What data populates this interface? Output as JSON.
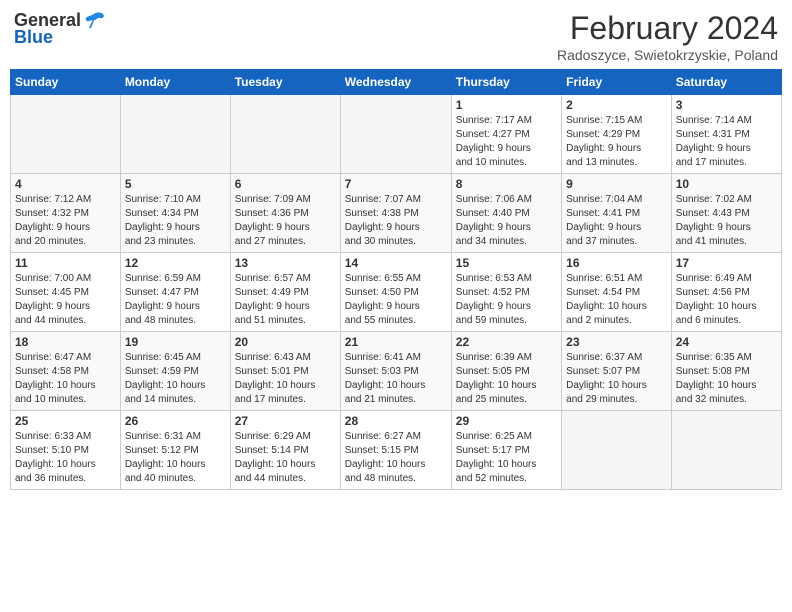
{
  "header": {
    "logo_general": "General",
    "logo_blue": "Blue",
    "month_year": "February 2024",
    "location": "Radoszyce, Swietokrzyskie, Poland"
  },
  "weekdays": [
    "Sunday",
    "Monday",
    "Tuesday",
    "Wednesday",
    "Thursday",
    "Friday",
    "Saturday"
  ],
  "weeks": [
    [
      {
        "day": "",
        "info": ""
      },
      {
        "day": "",
        "info": ""
      },
      {
        "day": "",
        "info": ""
      },
      {
        "day": "",
        "info": ""
      },
      {
        "day": "1",
        "info": "Sunrise: 7:17 AM\nSunset: 4:27 PM\nDaylight: 9 hours\nand 10 minutes."
      },
      {
        "day": "2",
        "info": "Sunrise: 7:15 AM\nSunset: 4:29 PM\nDaylight: 9 hours\nand 13 minutes."
      },
      {
        "day": "3",
        "info": "Sunrise: 7:14 AM\nSunset: 4:31 PM\nDaylight: 9 hours\nand 17 minutes."
      }
    ],
    [
      {
        "day": "4",
        "info": "Sunrise: 7:12 AM\nSunset: 4:32 PM\nDaylight: 9 hours\nand 20 minutes."
      },
      {
        "day": "5",
        "info": "Sunrise: 7:10 AM\nSunset: 4:34 PM\nDaylight: 9 hours\nand 23 minutes."
      },
      {
        "day": "6",
        "info": "Sunrise: 7:09 AM\nSunset: 4:36 PM\nDaylight: 9 hours\nand 27 minutes."
      },
      {
        "day": "7",
        "info": "Sunrise: 7:07 AM\nSunset: 4:38 PM\nDaylight: 9 hours\nand 30 minutes."
      },
      {
        "day": "8",
        "info": "Sunrise: 7:06 AM\nSunset: 4:40 PM\nDaylight: 9 hours\nand 34 minutes."
      },
      {
        "day": "9",
        "info": "Sunrise: 7:04 AM\nSunset: 4:41 PM\nDaylight: 9 hours\nand 37 minutes."
      },
      {
        "day": "10",
        "info": "Sunrise: 7:02 AM\nSunset: 4:43 PM\nDaylight: 9 hours\nand 41 minutes."
      }
    ],
    [
      {
        "day": "11",
        "info": "Sunrise: 7:00 AM\nSunset: 4:45 PM\nDaylight: 9 hours\nand 44 minutes."
      },
      {
        "day": "12",
        "info": "Sunrise: 6:59 AM\nSunset: 4:47 PM\nDaylight: 9 hours\nand 48 minutes."
      },
      {
        "day": "13",
        "info": "Sunrise: 6:57 AM\nSunset: 4:49 PM\nDaylight: 9 hours\nand 51 minutes."
      },
      {
        "day": "14",
        "info": "Sunrise: 6:55 AM\nSunset: 4:50 PM\nDaylight: 9 hours\nand 55 minutes."
      },
      {
        "day": "15",
        "info": "Sunrise: 6:53 AM\nSunset: 4:52 PM\nDaylight: 9 hours\nand 59 minutes."
      },
      {
        "day": "16",
        "info": "Sunrise: 6:51 AM\nSunset: 4:54 PM\nDaylight: 10 hours\nand 2 minutes."
      },
      {
        "day": "17",
        "info": "Sunrise: 6:49 AM\nSunset: 4:56 PM\nDaylight: 10 hours\nand 6 minutes."
      }
    ],
    [
      {
        "day": "18",
        "info": "Sunrise: 6:47 AM\nSunset: 4:58 PM\nDaylight: 10 hours\nand 10 minutes."
      },
      {
        "day": "19",
        "info": "Sunrise: 6:45 AM\nSunset: 4:59 PM\nDaylight: 10 hours\nand 14 minutes."
      },
      {
        "day": "20",
        "info": "Sunrise: 6:43 AM\nSunset: 5:01 PM\nDaylight: 10 hours\nand 17 minutes."
      },
      {
        "day": "21",
        "info": "Sunrise: 6:41 AM\nSunset: 5:03 PM\nDaylight: 10 hours\nand 21 minutes."
      },
      {
        "day": "22",
        "info": "Sunrise: 6:39 AM\nSunset: 5:05 PM\nDaylight: 10 hours\nand 25 minutes."
      },
      {
        "day": "23",
        "info": "Sunrise: 6:37 AM\nSunset: 5:07 PM\nDaylight: 10 hours\nand 29 minutes."
      },
      {
        "day": "24",
        "info": "Sunrise: 6:35 AM\nSunset: 5:08 PM\nDaylight: 10 hours\nand 32 minutes."
      }
    ],
    [
      {
        "day": "25",
        "info": "Sunrise: 6:33 AM\nSunset: 5:10 PM\nDaylight: 10 hours\nand 36 minutes."
      },
      {
        "day": "26",
        "info": "Sunrise: 6:31 AM\nSunset: 5:12 PM\nDaylight: 10 hours\nand 40 minutes."
      },
      {
        "day": "27",
        "info": "Sunrise: 6:29 AM\nSunset: 5:14 PM\nDaylight: 10 hours\nand 44 minutes."
      },
      {
        "day": "28",
        "info": "Sunrise: 6:27 AM\nSunset: 5:15 PM\nDaylight: 10 hours\nand 48 minutes."
      },
      {
        "day": "29",
        "info": "Sunrise: 6:25 AM\nSunset: 5:17 PM\nDaylight: 10 hours\nand 52 minutes."
      },
      {
        "day": "",
        "info": ""
      },
      {
        "day": "",
        "info": ""
      }
    ]
  ]
}
